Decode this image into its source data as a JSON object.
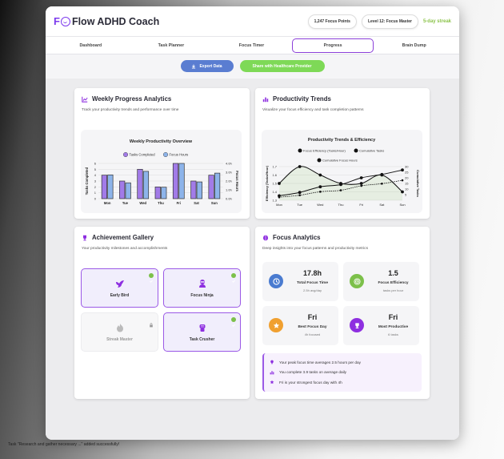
{
  "app": {
    "title": "Flow ADHD Coach",
    "logo_letter": "F",
    "points": "1,247 Focus Points",
    "level": "Level 12: Focus Master",
    "streak": "5-day streak"
  },
  "nav": {
    "tabs": [
      {
        "label": "Dashboard",
        "active": false
      },
      {
        "label": "Task Planner",
        "active": false
      },
      {
        "label": "Focus Timer",
        "active": false
      },
      {
        "label": "Progress",
        "active": true
      },
      {
        "label": "Brain Dump",
        "active": false
      }
    ]
  },
  "actions": {
    "export_label": "Export Data",
    "share_label": "Share with Healthcare Provider"
  },
  "weekly": {
    "title": "Weekly Progress Analytics",
    "subtitle": "Track your productivity trends and performance over time"
  },
  "trends": {
    "title": "Productivity Trends",
    "subtitle": "Visualize your focus efficiency and task completion patterns"
  },
  "achievements": {
    "title": "Achievement Gallery",
    "subtitle": "Your productivity milestones and accomplishments",
    "items": [
      {
        "name": "Early Bird",
        "unlocked": true,
        "icon": "bird-icon"
      },
      {
        "name": "Focus Ninja",
        "unlocked": true,
        "icon": "ninja-icon"
      },
      {
        "name": "Streak Master",
        "unlocked": false,
        "icon": "flame-icon"
      },
      {
        "name": "Task Crusher",
        "unlocked": true,
        "icon": "fist-icon"
      }
    ]
  },
  "analytics": {
    "title": "Focus Analytics",
    "subtitle": "Deep insights into your focus patterns and productivity metrics",
    "stats": [
      {
        "value": "17.8h",
        "label": "Total Focus Time",
        "sub": "2.5h avg/day",
        "color": "#4a7bd0",
        "icon": "clock-icon"
      },
      {
        "value": "1.5",
        "label": "Focus Efficiency",
        "sub": "tasks per hour",
        "color": "#7cc04a",
        "icon": "target-icon"
      },
      {
        "value": "Fri",
        "label": "Best Focus Day",
        "sub": "4h focused",
        "color": "#f0a030",
        "icon": "star-icon"
      },
      {
        "value": "Fri",
        "label": "Most Productive",
        "sub": "6 tasks",
        "color": "#8e2fe0",
        "icon": "trophy-icon"
      }
    ],
    "insights": [
      {
        "text": "Your peak focus time averages 2.5 hours per day",
        "icon": "bulb-icon"
      },
      {
        "text": "You complete 3.9 tasks on average daily",
        "icon": "chart-icon"
      },
      {
        "text": "Fri is your strongest focus day with 4h",
        "icon": "star-icon"
      }
    ]
  },
  "toast": "Task \"Research and gather necessary ...\" added successfully!",
  "chart_data": [
    {
      "type": "bar",
      "title": "Weekly Productivity Overview",
      "categories": [
        "Mon",
        "Tue",
        "Wed",
        "Thu",
        "Fri",
        "Sat",
        "Sun"
      ],
      "series": [
        {
          "name": "Tasks Completed",
          "axis": "left",
          "values": [
            4,
            3,
            5,
            2,
            6,
            3,
            4
          ],
          "color": "#a27be8"
        },
        {
          "name": "Focus Hours",
          "axis": "right",
          "values": [
            2.7,
            1.8,
            3.1,
            1.3,
            4.0,
            1.9,
            2.9
          ],
          "color": "#8db4ea"
        }
      ],
      "ylabel": "Tasks Completed",
      "y2label": "Focus Hours",
      "ylim": [
        0,
        6
      ],
      "y2lim": [
        0,
        4
      ],
      "yticks": [
        "0",
        "1",
        "2",
        "3",
        "4",
        "5",
        "6"
      ],
      "y2ticks": [
        "0.0h",
        "1.0h",
        "2.0h",
        "3.0h",
        "4.0h"
      ],
      "legend": "top"
    },
    {
      "type": "line",
      "title": "Productivity Trends & Efficiency",
      "categories": [
        "Mon",
        "Tue",
        "Wed",
        "Thu",
        "Fri",
        "Sat",
        "Sun"
      ],
      "series": [
        {
          "name": "Focus Efficiency (Tasks/Hour)",
          "axis": "left",
          "values": [
            1.5,
            1.7,
            1.6,
            1.5,
            1.5,
            1.6,
            1.4
          ],
          "color": "#222222"
        },
        {
          "name": "Cumulative Tasks",
          "axis": "right",
          "values": [
            4,
            7,
            12,
            14,
            20,
            23,
            27
          ],
          "color": "#222222"
        },
        {
          "name": "Cumulative Focus Hours",
          "axis": "right",
          "values": [
            2.7,
            4.5,
            7.6,
            8.9,
            12.9,
            14.8,
            17.8
          ],
          "color": "#222222"
        }
      ],
      "ylabel": "Efficiency (Tasks/Hour)",
      "y2label": "Cumulative Tasks",
      "ylim": [
        1.3,
        1.7
      ],
      "y2lim": [
        0,
        30
      ],
      "yticks": [
        "1.3",
        "1.4",
        "1.5",
        "1.6",
        "1.7"
      ],
      "y2ticks": [
        "5",
        "10",
        "15",
        "20",
        "25",
        "30"
      ],
      "legend": "top"
    }
  ]
}
